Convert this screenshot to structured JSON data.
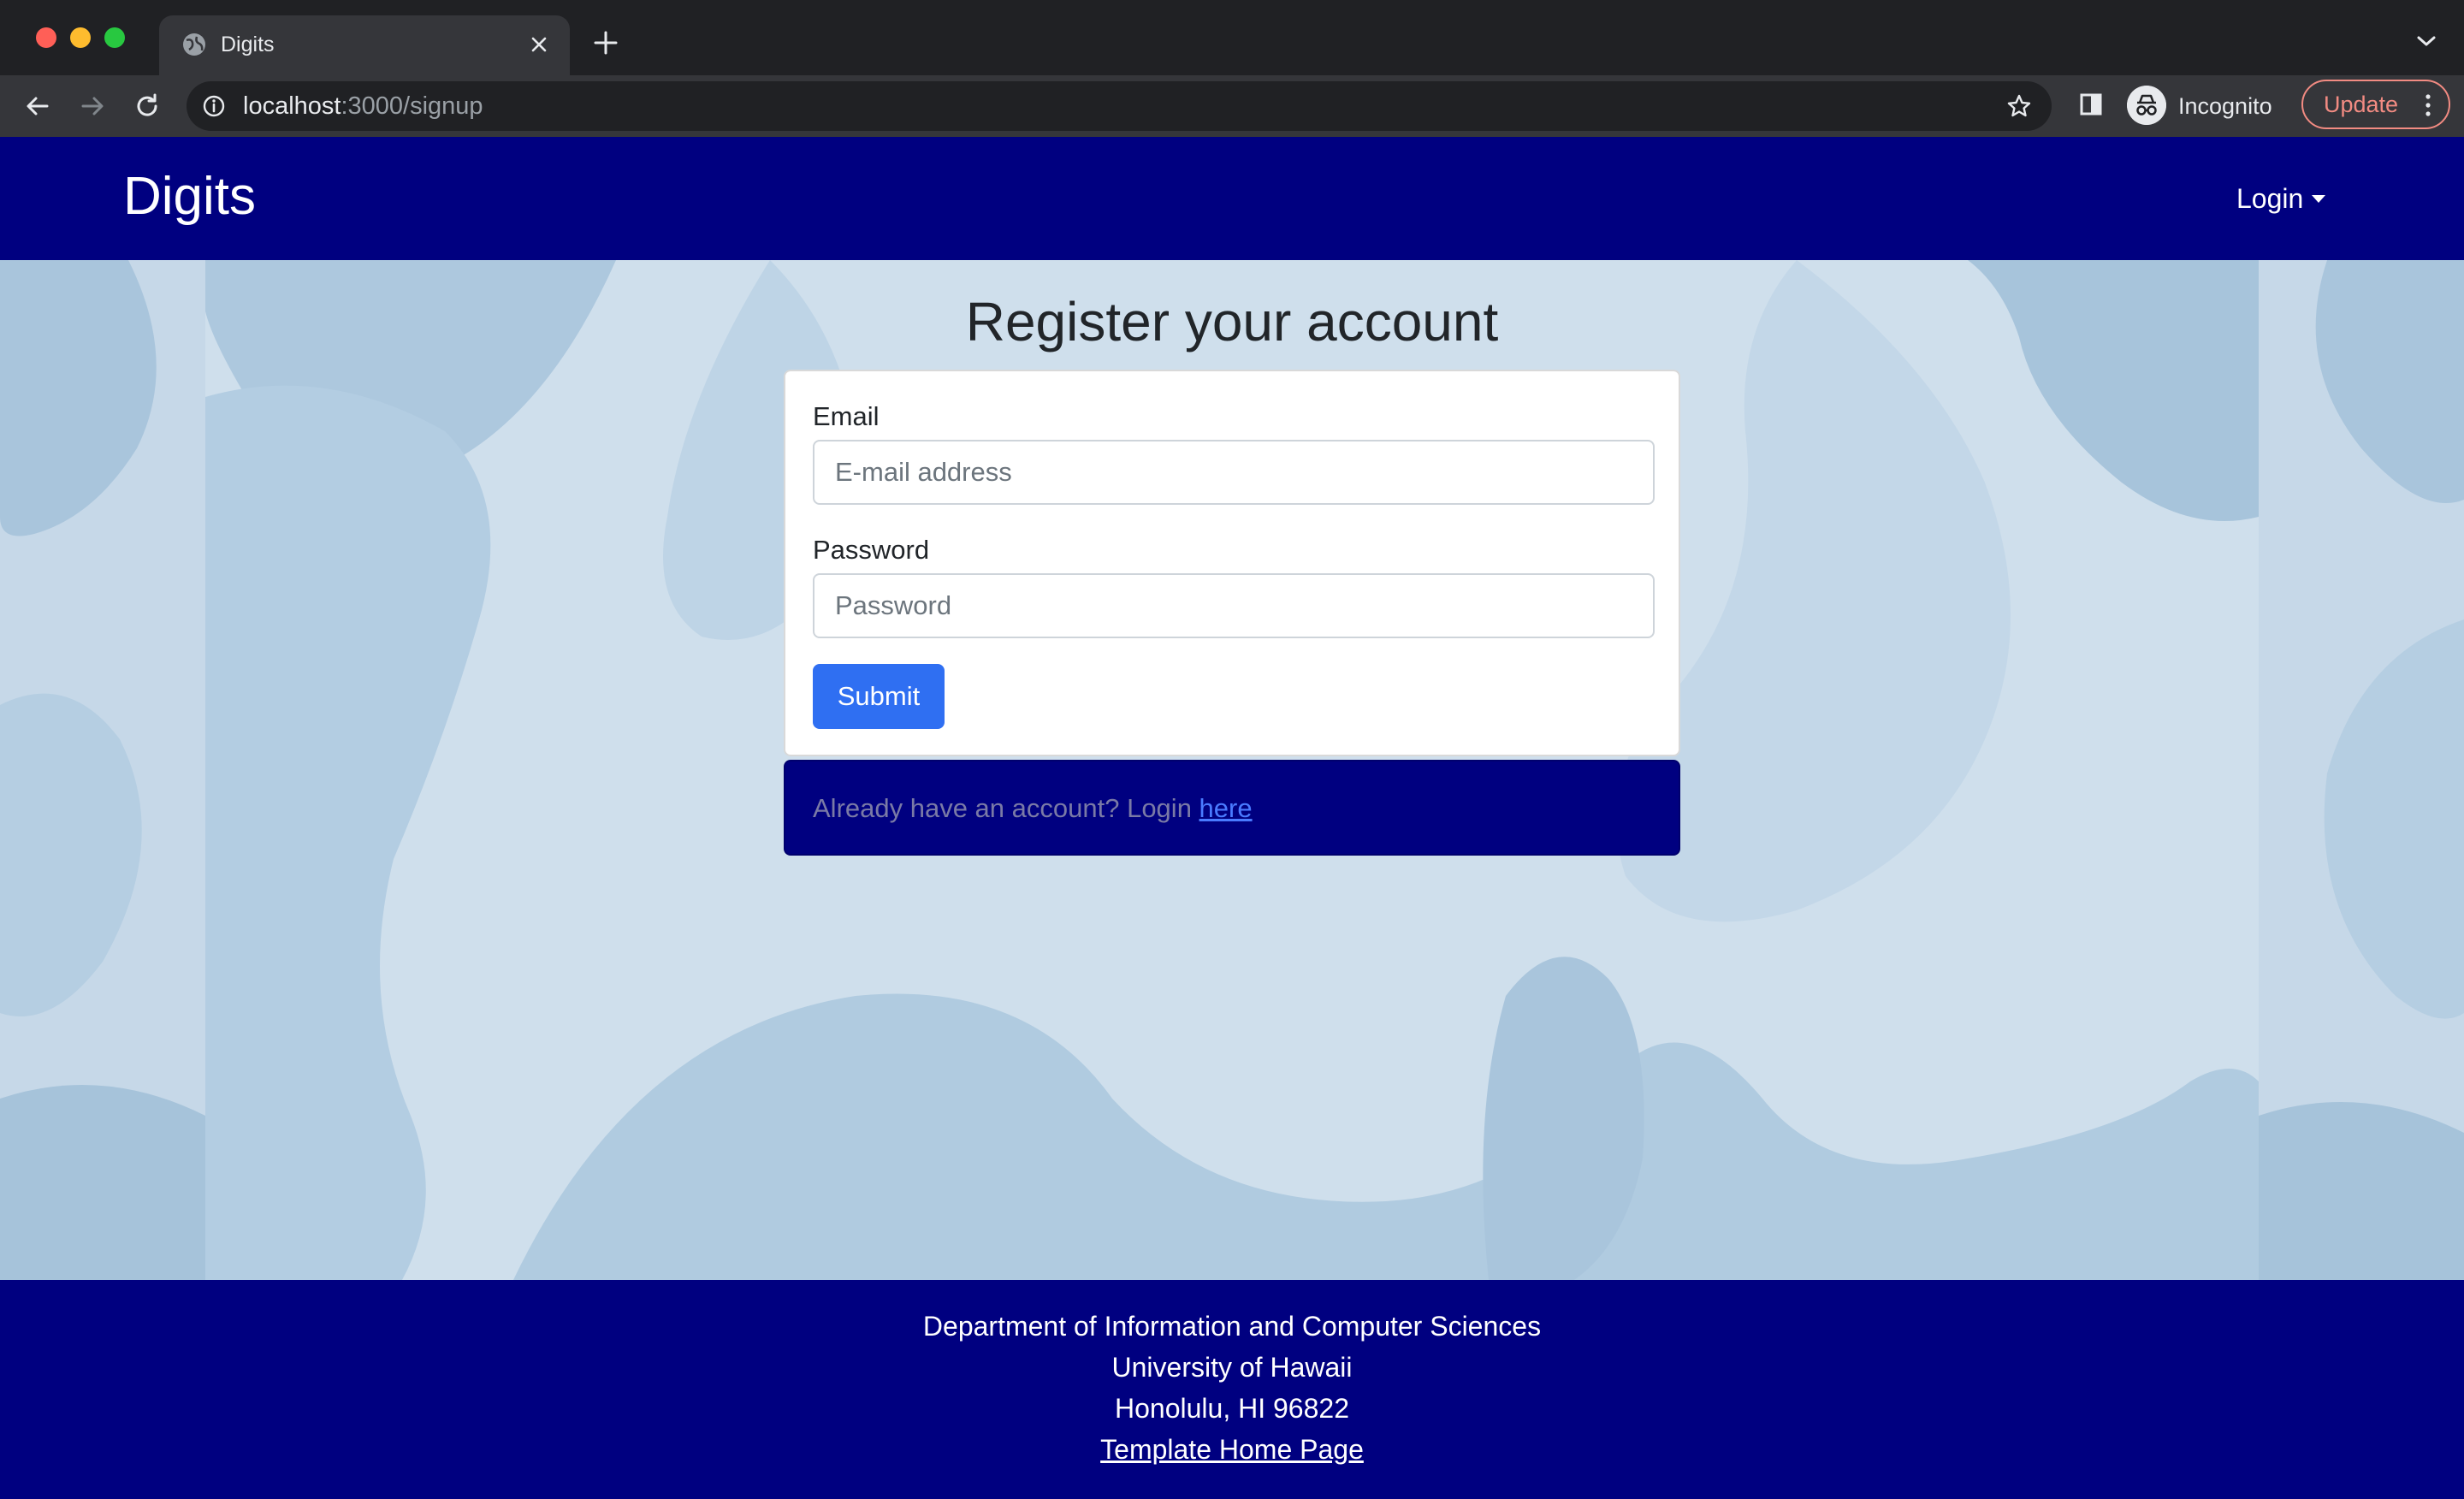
{
  "browser": {
    "tab_title": "Digits",
    "url_host": "localhost",
    "url_rest": ":3000/signup",
    "incognito_label": "Incognito",
    "update_label": "Update"
  },
  "navbar": {
    "brand": "Digits",
    "login_label": "Login"
  },
  "signup": {
    "title": "Register your account",
    "email_label": "Email",
    "email_placeholder": "E-mail address",
    "password_label": "Password",
    "password_placeholder": "Password",
    "submit_label": "Submit",
    "already_text": "Already have an account? Login ",
    "here_link": "here"
  },
  "footer": {
    "line1": "Department of Information and Computer Sciences",
    "line2": "University of Hawaii",
    "line3": "Honolulu, HI 96822",
    "template_link": "Template Home Page"
  },
  "colors": {
    "navbar_bg": "#000080",
    "primary_button": "#2f6ff2",
    "link": "#4a7bff",
    "page_bg": "#cfdfec"
  },
  "icons": [
    "globe-icon",
    "close-icon",
    "plus-icon",
    "chevron-down-icon",
    "back-arrow-icon",
    "forward-arrow-icon",
    "reload-icon",
    "info-icon",
    "star-icon",
    "side-panel-icon",
    "incognito-icon",
    "kebab-menu-icon",
    "caret-down-icon"
  ]
}
